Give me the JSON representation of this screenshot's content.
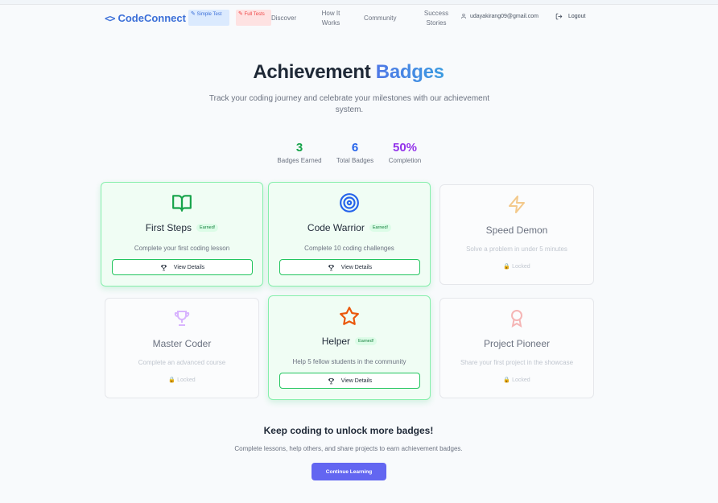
{
  "header": {
    "logo_text": "CodeConnect",
    "logo_icon": "code-brackets-icon",
    "simple_pill": "Simple Test",
    "full_pill": "Full Tests",
    "nav": {
      "discover": "Discover",
      "how_it_works": "How It Works",
      "community": "Community",
      "success_stories": "Success Stories"
    },
    "user_email": "udayakirang09@gmail.com",
    "logout_label": "Logout"
  },
  "hero": {
    "title_main": "Achievement",
    "title_accent": "Badges",
    "subtitle": "Track your coding journey and celebrate your milestones with our achievement system."
  },
  "stats": [
    {
      "value": "3",
      "label": "Badges Earned",
      "color": "#16a34a"
    },
    {
      "value": "6",
      "label": "Total Badges",
      "color": "#2563eb"
    },
    {
      "value": "50%",
      "label": "Completion",
      "color": "#9333ea"
    }
  ],
  "badges": [
    {
      "name": "First Steps",
      "description": "Complete your first coding lesson",
      "earned": true,
      "earned_label": "Earned!",
      "button_label": "View Details",
      "icon": "book-icon",
      "icon_color": "#16a34a"
    },
    {
      "name": "Code Warrior",
      "description": "Complete 10 coding challenges",
      "earned": true,
      "earned_label": "Earned!",
      "button_label": "View Details",
      "icon": "target-icon",
      "icon_color": "#2563eb"
    },
    {
      "name": "Speed Demon",
      "description": "Solve a problem in under 5 minutes",
      "earned": false,
      "locked_label": "Locked",
      "icon": "lightning-icon",
      "icon_color": "#f3c98b"
    },
    {
      "name": "Master Coder",
      "description": "Complete an advanced course",
      "earned": false,
      "locked_label": "Locked",
      "icon": "trophy-icon",
      "icon_color": "#d8b4fe"
    },
    {
      "name": "Helper",
      "description": "Help 5 fellow students in the community",
      "earned": true,
      "earned_label": "Earned!",
      "button_label": "View Details",
      "icon": "star-icon",
      "icon_color": "#ea580c"
    },
    {
      "name": "Project Pioneer",
      "description": "Share your first project in the showcase",
      "earned": false,
      "locked_label": "Locked",
      "icon": "award-icon",
      "icon_color": "#f5b5b5"
    }
  ],
  "cta": {
    "title": "Keep coding to unlock more badges!",
    "subtitle": "Complete lessons, help others, and share projects to earn achievement badges.",
    "button_label": "Continue Learning",
    "button_color": "#6366f1"
  }
}
